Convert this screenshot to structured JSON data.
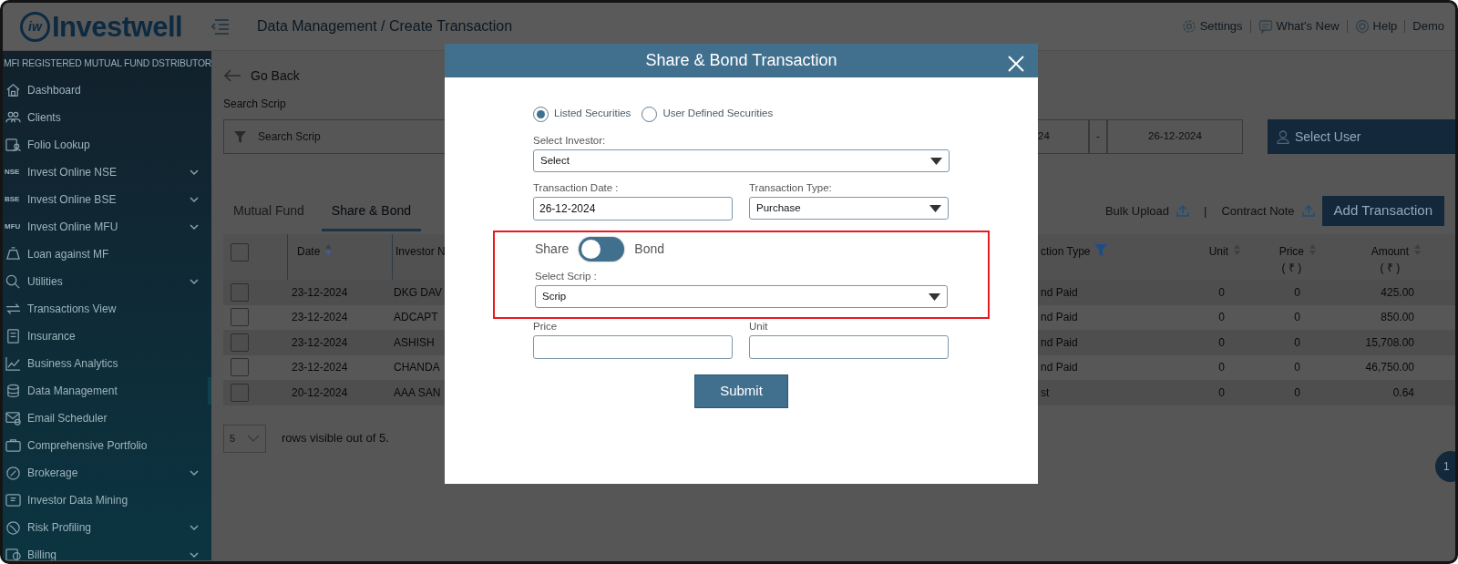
{
  "header": {
    "logo_mark": "iw",
    "logo": "Investwell",
    "breadcrumb": "Data Management / Create Transaction",
    "links": [
      "Settings",
      "What's New",
      "Help"
    ],
    "user": "Demo"
  },
  "sidebar": {
    "caption": "MFI REGISTERED MUTUAL FUND DSTRIBUTOR",
    "items": [
      {
        "label": "Dashboard",
        "has_submenu": false,
        "selected": false
      },
      {
        "label": "Clients",
        "has_submenu": false,
        "selected": false
      },
      {
        "label": "Folio Lookup",
        "has_submenu": false,
        "selected": false
      },
      {
        "label": "Invest Online NSE",
        "badge": "NSE",
        "has_submenu": true,
        "selected": false
      },
      {
        "label": "Invest Online BSE",
        "badge": "BSE",
        "has_submenu": true,
        "selected": false
      },
      {
        "label": "Invest Online MFU",
        "badge": "MFU",
        "has_submenu": true,
        "selected": false
      },
      {
        "label": "Loan against MF",
        "has_submenu": false,
        "selected": false
      },
      {
        "label": "Utilities",
        "has_submenu": true,
        "selected": false
      },
      {
        "label": "Transactions View",
        "has_submenu": false,
        "selected": false
      },
      {
        "label": "Insurance",
        "has_submenu": false,
        "selected": false
      },
      {
        "label": "Business Analytics",
        "has_submenu": false,
        "selected": false
      },
      {
        "label": "Data Management",
        "has_submenu": false,
        "selected": true
      },
      {
        "label": "Email Scheduler",
        "has_submenu": false,
        "selected": false
      },
      {
        "label": "Comprehensive Portfolio",
        "has_submenu": false,
        "selected": false
      },
      {
        "label": "Brokerage",
        "has_submenu": true,
        "selected": false
      },
      {
        "label": "Investor Data Mining",
        "has_submenu": false,
        "selected": false
      },
      {
        "label": "Risk Profiling",
        "has_submenu": true,
        "selected": false
      },
      {
        "label": "Billing",
        "has_submenu": true,
        "selected": false
      }
    ]
  },
  "page": {
    "back": "Go Back",
    "search_label": "Search Scrip",
    "search_placeholder": "Search Scrip",
    "date_from": "24",
    "date_separator": "-",
    "date_to": "26-12-2024",
    "user_select": "Select User",
    "tabs": [
      {
        "label": "Mutual Fund",
        "selected": false
      },
      {
        "label": "Share & Bond",
        "selected": true
      }
    ],
    "actions": [
      "Bulk Upload",
      "Contract Note"
    ],
    "separator": "|",
    "add_button": "Add Transaction",
    "table": {
      "header_checked": false,
      "columns": [
        {
          "label": "Date",
          "sorted": true
        },
        {
          "label": "Investor N"
        },
        {
          "label": "ction Type",
          "filter": true
        },
        {
          "label": "Unit",
          "sorted": false
        },
        {
          "label": "Price",
          "unit": "( ₹ )",
          "sorted": false
        },
        {
          "label": "Amount",
          "unit": "( ₹ )",
          "sorted": false
        }
      ],
      "rows": [
        {
          "checked": false,
          "cells": [
            "23-12-2024",
            "DKG DAV",
            "nd Paid",
            "0",
            "0",
            "425.00"
          ]
        },
        {
          "checked": false,
          "cells": [
            "23-12-2024",
            "ADCAPT",
            "nd Paid",
            "0",
            "0",
            "850.00"
          ]
        },
        {
          "checked": false,
          "cells": [
            "23-12-2024",
            "ASHISH",
            "nd Paid",
            "0",
            "0",
            "15,708.00"
          ]
        },
        {
          "checked": false,
          "cells": [
            "23-12-2024",
            "CHANDA",
            "nd Paid",
            "0",
            "0",
            "46,750.00"
          ]
        },
        {
          "checked": false,
          "cells": [
            "20-12-2024",
            "AAA SAN",
            "st",
            "0",
            "0",
            "0.64"
          ]
        }
      ]
    },
    "page_size": "5",
    "rows_info": "rows visible out of 5.",
    "page_badge": "1"
  },
  "modal": {
    "title": "Share & Bond Transaction",
    "radios": [
      {
        "label": "Listed Securities",
        "selected": true
      },
      {
        "label": "User Defined Securities",
        "selected": false
      }
    ],
    "investor_label": "Select Investor:",
    "investor_value": "Select",
    "date_label": "Transaction Date :",
    "date_value": "26-12-2024",
    "type_label": "Transaction Type:",
    "type_value": "Purchase",
    "toggle": {
      "left": "Share",
      "right": "Bond",
      "on": false
    },
    "scrip_label": "Select Scrip :",
    "scrip_value": "Scrip",
    "price_label": "Price",
    "unit_label": "Unit",
    "submit": "Submit"
  }
}
